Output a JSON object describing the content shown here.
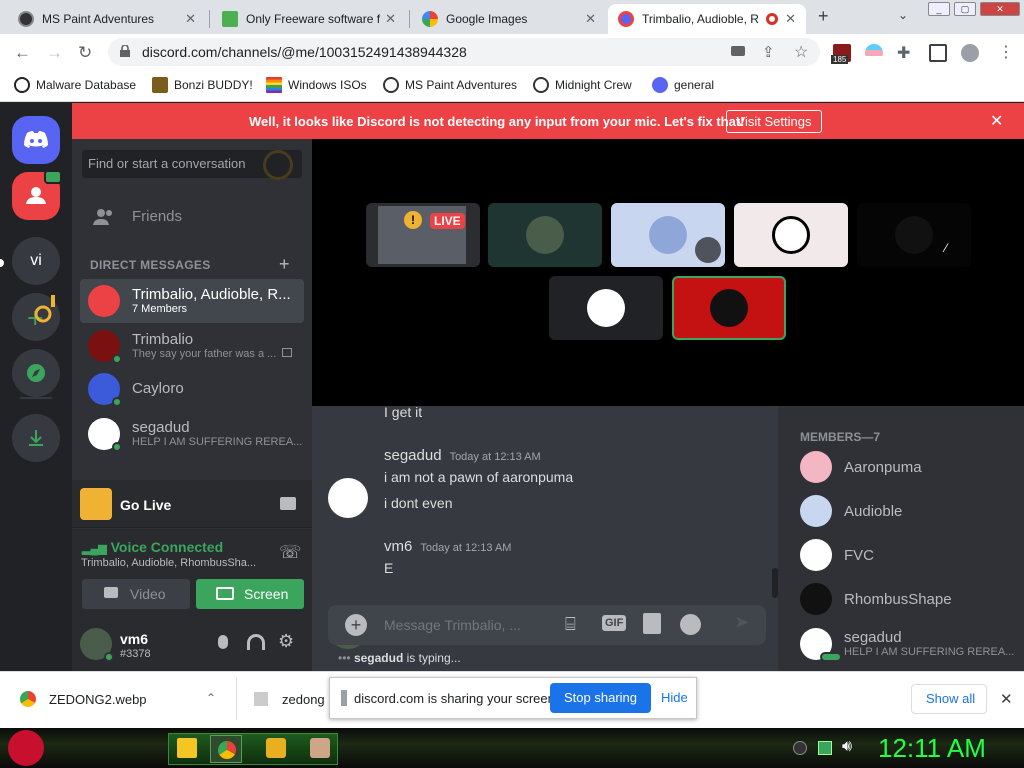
{
  "browser": {
    "tabs": [
      {
        "title": "MS Paint Adventures",
        "close": "✕"
      },
      {
        "title": "Only Freeware software f",
        "close": "✕"
      },
      {
        "title": "Google Images",
        "close": "✕"
      },
      {
        "title": "Trimbalio, Audioble, R",
        "close": "✕"
      }
    ],
    "new_tab": "+",
    "url": "discord.com/channels/@me/1003152491438944328",
    "badge_count": "185",
    "bookmarks": [
      {
        "label": "Malware Database",
        "color": "#222222"
      },
      {
        "label": "Bonzi BUDDY!",
        "color": "#7a5c1e"
      },
      {
        "label": "Windows ISOs",
        "color": "#e53935"
      },
      {
        "label": "MS Paint Adventures",
        "color": "#333333"
      },
      {
        "label": "Midnight Crew",
        "color": "#333333"
      },
      {
        "label": "general",
        "color": "#5865f2"
      }
    ]
  },
  "discord": {
    "notice": "Well, it looks like Discord is not detecting any input from your mic. Let's fix that!",
    "notice_button": "Visit Settings",
    "search_placeholder": "Find or start a conversation",
    "friends": "Friends",
    "dm_header": "DIRECT MESSAGES",
    "guild_vi": "vi",
    "dms": [
      {
        "name": "Trimbalio, Audioble, R...",
        "sub": "7 Members",
        "color": "#ed4245"
      },
      {
        "name": "Trimbalio",
        "sub": "They say your father was a ...",
        "color": "#7a1010"
      },
      {
        "name": "Cayloro",
        "sub": "",
        "color": "#3b5bdb"
      },
      {
        "name": "segadud",
        "sub": "HELP I AM SUFFERING REREA...",
        "color": "#ffffff"
      }
    ],
    "go_live": "Go Live",
    "voice": {
      "status": "Voice Connected",
      "channel": "Trimbalio, Audioble, RhombusSha...",
      "video": "Video",
      "screen": "Screen"
    },
    "user": {
      "name": "vm6",
      "tag": "#3378"
    },
    "live_badge": "LIVE",
    "messages": [
      {
        "author": "",
        "time": "",
        "lines": [
          "I get it"
        ]
      },
      {
        "author": "segadud",
        "time": "Today at 12:13 AM",
        "lines": [
          "i am not a pawn of aaronpuma",
          "i dont even"
        ]
      },
      {
        "author": "vm6",
        "time": "Today at 12:13 AM",
        "lines": [
          "E"
        ]
      }
    ],
    "message_placeholder": "Message Trimbalio, ...",
    "typing_user": "segadud",
    "typing_suffix": "is typing...",
    "members_header": "MEMBERS—7",
    "members": [
      {
        "name": "Aaronpuma",
        "sub": "",
        "color": "#f4b6c2"
      },
      {
        "name": "Audioble",
        "sub": "",
        "color": "#c9d6f0"
      },
      {
        "name": "FVC",
        "sub": "",
        "color": "#ffffff"
      },
      {
        "name": "RhombusShape",
        "sub": "",
        "color": "#111111"
      },
      {
        "name": "segadud",
        "sub": "HELP I AM SUFFERING REREA...",
        "color": "#ffffff"
      }
    ]
  },
  "downloads": {
    "file1": "ZEDONG2.webp",
    "file2": "zedong",
    "share_text": "discord.com is sharing your screen.",
    "stop": "Stop sharing",
    "hide": "Hide",
    "show_all": "Show all"
  },
  "taskbar": {
    "clock": "12:11 AM"
  }
}
